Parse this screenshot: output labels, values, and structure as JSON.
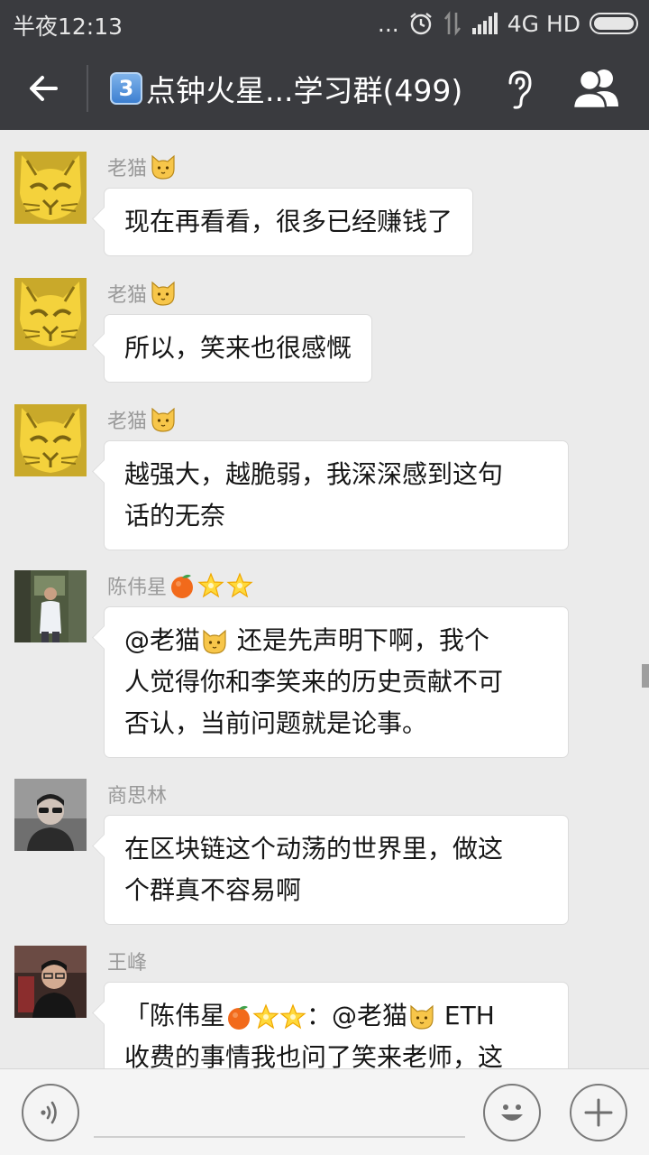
{
  "status_bar": {
    "time": "半夜12:13",
    "dots": "...",
    "network_text": "4G HD",
    "icons": [
      "alarm-icon",
      "data-transfer-icon",
      "signal-icon",
      "battery-icon"
    ]
  },
  "header": {
    "badge": "3",
    "title": "点钟火星...学习群(499)",
    "icons": [
      "back-arrow-icon",
      "ear-icon",
      "group-members-icon"
    ]
  },
  "messages": [
    {
      "sender": "老猫",
      "sender_emoji": [
        "cat-emoji"
      ],
      "lines": [
        "现在再看看，很多已经赚钱了"
      ]
    },
    {
      "sender": "老猫",
      "sender_emoji": [
        "cat-emoji"
      ],
      "lines": [
        "所以，笑来也很感慨"
      ]
    },
    {
      "sender": "老猫",
      "sender_emoji": [
        "cat-emoji"
      ],
      "lines": [
        "越强大，越脆弱，我深深感到这句",
        "话的无奈"
      ]
    },
    {
      "sender": "陈伟星",
      "sender_emoji": [
        "orange-emoji",
        "star-emoji",
        "star-emoji"
      ],
      "lines_before": "@老猫",
      "line1_after": " 还是先声明下啊，我个",
      "lines": [
        "人觉得你和李笑来的历史贡献不可",
        "否认，当前问题就是论事。"
      ]
    },
    {
      "sender": "商思林",
      "sender_emoji": [],
      "lines": [
        "在区块链这个动荡的世界里，做这",
        "个群真不容易啊"
      ]
    },
    {
      "sender": "王峰",
      "sender_emoji": [],
      "quote_open": "「陈伟星",
      "quote_mid": "：@老猫",
      "quote_after": " ETH",
      "lines": [
        "收费的事情我也问了笑来老师，这"
      ]
    }
  ],
  "input_bar": {
    "placeholder": "",
    "icons": [
      "voice-icon",
      "emoji-icon",
      "plus-icon"
    ]
  },
  "colors": {
    "header_bg": "#3a3b3f",
    "chat_bg": "#ebebeb",
    "bubble_bg": "#ffffff",
    "sender_text": "#9a9a9a"
  }
}
